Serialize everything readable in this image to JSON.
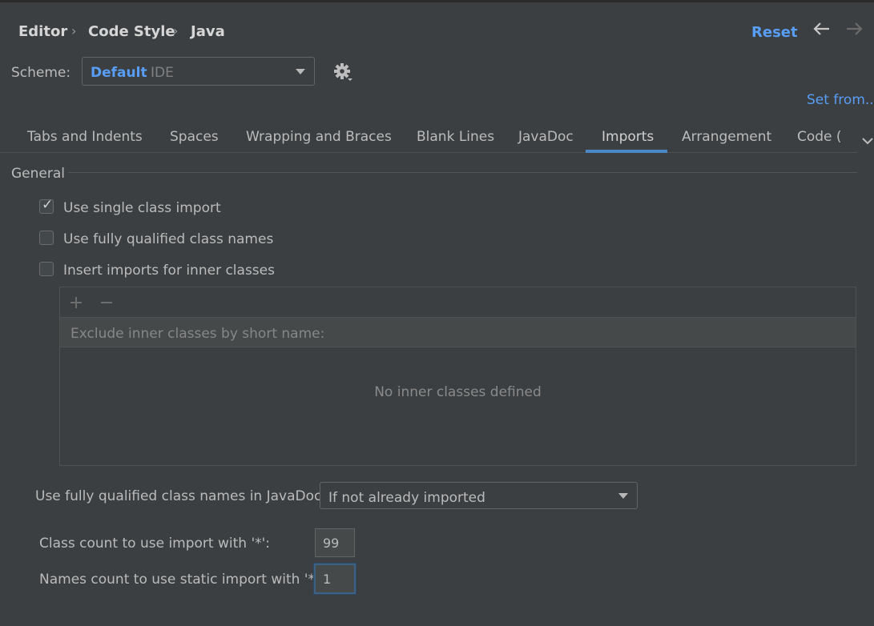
{
  "breadcrumb": [
    "Editor",
    "Code Style",
    "Java"
  ],
  "header": {
    "reset_label": "Reset",
    "back_icon": "arrow-left-icon",
    "forward_icon": "arrow-right-icon"
  },
  "scheme": {
    "label": "Scheme:",
    "name": "Default",
    "type": "IDE",
    "set_from": "Set from..."
  },
  "tabs": [
    "Tabs and Indents",
    "Spaces",
    "Wrapping and Braces",
    "Blank Lines",
    "JavaDoc",
    "Imports",
    "Arrangement",
    "Code ("
  ],
  "active_tab": "Imports",
  "general": {
    "title": "General",
    "checkboxes": [
      {
        "label": "Use single class import",
        "checked": true
      },
      {
        "label": "Use fully qualified class names",
        "checked": false
      },
      {
        "label": "Insert imports for inner classes",
        "checked": false
      }
    ]
  },
  "inner_classes": {
    "header": "Exclude inner classes by short name:",
    "empty_text": "No inner classes defined",
    "add_icon": "plus-icon",
    "remove_icon": "minus-icon"
  },
  "javadoc": {
    "label": "Use fully qualified class names in JavaDoc:",
    "value": "If not already imported"
  },
  "counts": {
    "class_label": "Class count to use import with '*':",
    "class_value": "99",
    "names_label": "Names count to use static import with '*':",
    "names_value": "1"
  },
  "colors": {
    "background": "#3c3f41",
    "accent": "#589df6",
    "tab_underline": "#4a88c7"
  }
}
